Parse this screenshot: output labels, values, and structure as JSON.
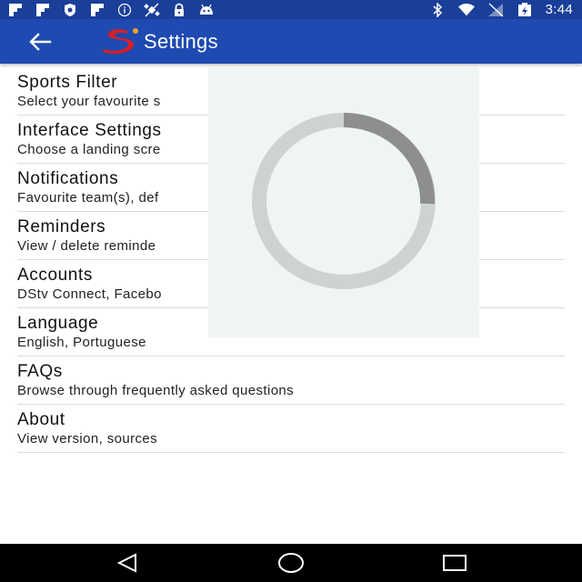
{
  "status_bar": {
    "time": "3:44",
    "left_icons": [
      "flipboard-icon",
      "flipboard-icon",
      "shield-icon",
      "flipboard-icon",
      "info-icon",
      "satellite-off-icon",
      "lock-icon",
      "android-icon"
    ],
    "right_icons": [
      "bluetooth-icon",
      "wifi-icon",
      "signal-icon",
      "battery-charging-icon"
    ]
  },
  "app_bar": {
    "title": "Settings",
    "back_icon": "arrow-back-icon",
    "logo": "supersport-logo"
  },
  "settings": [
    {
      "title": "Sports Filter",
      "subtitle": "Select your favourite s"
    },
    {
      "title": "Interface Settings",
      "subtitle": "Choose a landing scre"
    },
    {
      "title": "Notifications",
      "subtitle": "Favourite team(s), def"
    },
    {
      "title": "Reminders",
      "subtitle": "View / delete reminde"
    },
    {
      "title": "Accounts",
      "subtitle": "DStv Connect, Facebo"
    },
    {
      "title": "Language",
      "subtitle": "English, Portuguese"
    },
    {
      "title": "FAQs",
      "subtitle": "Browse through frequently asked questions"
    },
    {
      "title": "About",
      "subtitle": "View version, sources"
    }
  ],
  "loading": {
    "icon": "loading-spinner-icon"
  },
  "nav_bar": {
    "back": "nav-back-icon",
    "home": "nav-home-icon",
    "recents": "nav-recents-icon"
  },
  "colors": {
    "status_bar": "#1a3f99",
    "app_bar": "#1e4ab1",
    "divider": "#dcdcdc",
    "overlay": "#eff5f5",
    "logo_red": "#d42027",
    "logo_gold": "#f5a623"
  }
}
